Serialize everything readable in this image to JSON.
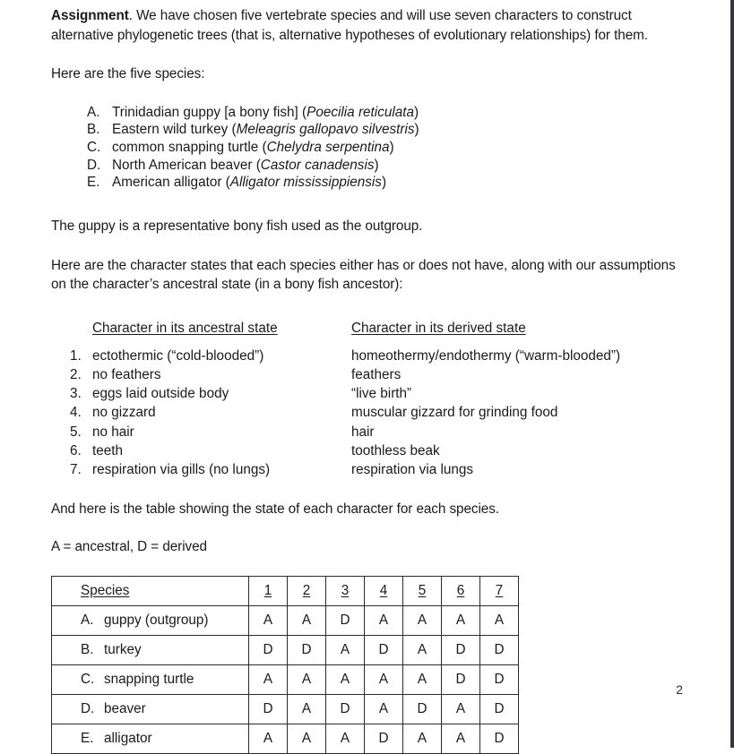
{
  "document": {
    "page_number": "2",
    "intro_paragraph": {
      "lead_bold": "Assignment",
      "rest": ". We have chosen five vertebrate species and will use seven characters to construct alternative phylogenetic trees (that is, alternative hypotheses of evolutionary relationships) for them."
    },
    "species_intro": "Here are the five species:",
    "species_list": [
      {
        "marker": "A.",
        "common": "Trinidadian guppy [a bony fish] (",
        "scientific": "Poecilia reticulata",
        "close": ")"
      },
      {
        "marker": "B.",
        "common": "Eastern wild turkey (",
        "scientific": "Meleagris gallopavo silvestris",
        "close": ")"
      },
      {
        "marker": "C.",
        "common": "common snapping turtle (",
        "scientific": "Chelydra serpentina",
        "close": ")"
      },
      {
        "marker": "D.",
        "common": "North American beaver (",
        "scientific": "Castor canadensis",
        "close": ")"
      },
      {
        "marker": "E.",
        "common": "American alligator (",
        "scientific": "Alligator mississippiensis",
        "close": ")"
      }
    ],
    "outgroup_note": "The guppy is a representative bony fish used as the outgroup.",
    "character_intro": "Here are the character states that each species either has or does not have, along with our assumptions on the character’s ancestral state (in a bony fish ancestor):",
    "character_table_headers": {
      "ancestral": "Character in its ancestral state",
      "derived": "Character in its derived state"
    },
    "characters": [
      {
        "marker": "1.",
        "ancestral": "ectothermic (“cold-blooded”)",
        "derived": "homeothermy/endothermy (“warm-blooded”)"
      },
      {
        "marker": "2.",
        "ancestral": "no feathers",
        "derived": "feathers"
      },
      {
        "marker": "3.",
        "ancestral": "eggs laid outside body",
        "derived": "“live birth”"
      },
      {
        "marker": "4.",
        "ancestral": "no gizzard",
        "derived": "muscular gizzard for grinding food"
      },
      {
        "marker": "5.",
        "ancestral": "no hair",
        "derived": "hair"
      },
      {
        "marker": "6.",
        "ancestral": "teeth",
        "derived": "toothless beak"
      },
      {
        "marker": "7.",
        "ancestral": "respiration via gills (no lungs)",
        "derived": "respiration via lungs"
      }
    ],
    "table_intro": "And here is the table showing the state of each character for each species.",
    "legend": "A = ancestral, D = derived",
    "matrix": {
      "species_header": "Species",
      "character_headers": [
        "1",
        "2",
        "3",
        "4",
        "5",
        "6",
        "7"
      ],
      "rows": [
        {
          "marker": "A.",
          "name": "guppy (outgroup)",
          "states": [
            "A",
            "A",
            "D",
            "A",
            "A",
            "A",
            "A"
          ]
        },
        {
          "marker": "B.",
          "name": "turkey",
          "states": [
            "D",
            "D",
            "A",
            "D",
            "A",
            "D",
            "D"
          ]
        },
        {
          "marker": "C.",
          "name": "snapping turtle",
          "states": [
            "A",
            "A",
            "A",
            "A",
            "A",
            "D",
            "D"
          ]
        },
        {
          "marker": "D.",
          "name": "beaver",
          "states": [
            "D",
            "A",
            "D",
            "A",
            "D",
            "A",
            "D"
          ]
        },
        {
          "marker": "E.",
          "name": "alligator",
          "states": [
            "A",
            "A",
            "A",
            "D",
            "A",
            "A",
            "D"
          ]
        }
      ]
    }
  }
}
